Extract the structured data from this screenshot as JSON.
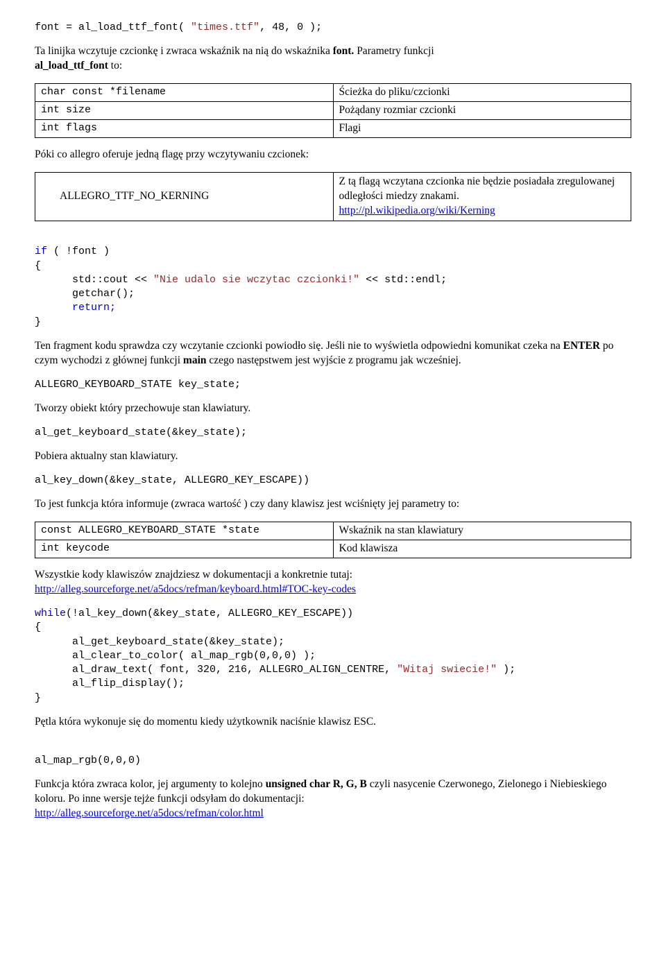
{
  "c1": {
    "line": "font = al_load_ttf_font( \"times.ttf\", 48, 0 );"
  },
  "p1": {
    "txt1": "Ta linijka wczytuje czcionkę i zwraca wskaźnik na nią do wskaźnika ",
    "b1": "font.",
    "txt2": " Parametry funkcji ",
    "b2": "al_load_ttf_font",
    "txt3": " to:"
  },
  "t1": {
    "r1": {
      "a": "char const *filename",
      "b": "Ścieżka do pliku/czcionki"
    },
    "r2": {
      "a": "int size",
      "b": "Pożądany rozmiar czcionki"
    },
    "r3": {
      "a": "int flags",
      "b": "Flagi"
    }
  },
  "p2": "Póki co allegro oferuje jedną flagę przy wczytywaniu czcionek:",
  "t2": {
    "a": "ALLEGRO_TTF_NO_KERNING",
    "b1": "Z tą flagą wczytana czcionka nie będzie posiadała zregulowanej odległości miedzy znakami. ",
    "link": "http://pl.wikipedia.org/wiki/Kerning"
  },
  "c2": {
    "l1a": "if",
    " l1b": " ( !font )",
    "l2": "{",
    "l3a": "      std::cout << ",
    "l3b": "\"Nie udalo sie wczytac czcionki!\"",
    "l3c": " << std::endl;",
    "l4": "      getchar();",
    "l5a": "      ",
    "l5b": "return;",
    "l6": "}"
  },
  "p3": {
    "t1": "Ten fragment kodu sprawdza czy wczytanie czcionki powiodło się. Jeśli nie to wyświetla odpowiedni komunikat czeka na ",
    "b1": "ENTER",
    "t2": " po czym wychodzi z głównej funkcji ",
    "b2": "main",
    "t3": " czego następstwem jest wyjście z programu jak wcześniej."
  },
  "c3": "ALLEGRO_KEYBOARD_STATE key_state;",
  "p4": "Tworzy obiekt który przechowuje stan klawiatury.",
  "c4": "al_get_keyboard_state(&key_state);",
  "p5": "Pobiera aktualny stan klawiatury.",
  "c5": "al_key_down(&key_state, ALLEGRO_KEY_ESCAPE))",
  "p6": "To jest funkcja która informuje (zwraca wartość ) czy dany klawisz jest wciśnięty jej parametry to:",
  "t3": {
    "r1": {
      "a": "const ALLEGRO_KEYBOARD_STATE *state",
      "b": "Wskaźnik na stan klawiatury"
    },
    "r2": {
      "a": "int keycode",
      "b": "Kod klawisza"
    }
  },
  "p7": {
    "t1": "Wszystkie kody klawiszów znajdziesz w dokumentacji a konkretnie tutaj: ",
    "link": "http://alleg.sourceforge.net/a5docs/refman/keyboard.html#TOC-key-codes"
  },
  "c6": {
    "l1a": "while",
    "l1b": "(!al_key_down(&key_state, ALLEGRO_KEY_ESCAPE))",
    "l2": "{",
    "l3": "      al_get_keyboard_state(&key_state);",
    "l4": "      al_clear_to_color( al_map_rgb(0,0,0) );",
    "l5a": "      al_draw_text( font, 320, 216, ALLEGRO_ALIGN_CENTRE, ",
    "l5b": "\"Witaj swiecie!\"",
    "l5c": " );",
    "l6": "      al_flip_display();",
    "l7": "}"
  },
  "p8": "Pętla która wykonuje się do momentu kiedy użytkownik naciśnie klawisz ESC.",
  "c7": "al_map_rgb(0,0,0)",
  "p9": {
    "t1": "Funkcja która zwraca kolor, jej argumenty to kolejno ",
    "b1": "unsigned char R, G, B",
    "t2": " czyli nasycenie Czerwonego, Zielonego i Niebieskiego koloru. Po inne wersje tejże funkcji odsyłam do dokumentacji: ",
    "link": "http://alleg.sourceforge.net/a5docs/refman/color.html"
  }
}
